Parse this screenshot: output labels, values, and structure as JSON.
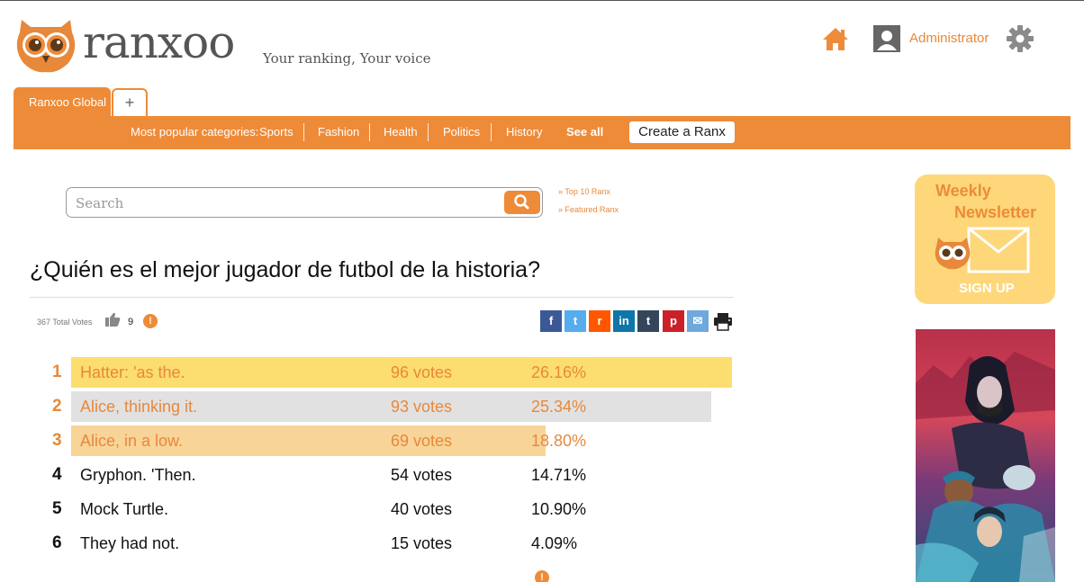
{
  "brand": {
    "name": "ranxoo",
    "tagline": "Your ranking, Your voice"
  },
  "header": {
    "user_name": "Administrator"
  },
  "tabs": {
    "active": "Ranxoo Global",
    "add": "+"
  },
  "categories": {
    "label": "Most popular categories:",
    "items": [
      "Sports",
      "Fashion",
      "Health",
      "Politics",
      "History"
    ],
    "see_all": "See all",
    "create_button": "Create a Ranx"
  },
  "search": {
    "placeholder": "Search"
  },
  "side_links": [
    "» Top 10 Ranx",
    "» Featured Ranx"
  ],
  "ranking": {
    "title": "¿Quién es el mejor jugador de futbol de la historia?",
    "total_votes_label": "367 Total Votes",
    "likes": "9",
    "rows": [
      {
        "rank": "1",
        "name": "Hatter: 'as the.",
        "votes": "96 votes",
        "percent": "26.16%",
        "share": 26.16,
        "bar_color": "#fcdd6f",
        "text_color": "#e8883a"
      },
      {
        "rank": "2",
        "name": "Alice, thinking it.",
        "votes": "93 votes",
        "percent": "25.34%",
        "share": 25.34,
        "bar_color": "#e1e1e1",
        "text_color": "#e8883a"
      },
      {
        "rank": "3",
        "name": "Alice, in a low.",
        "votes": "69 votes",
        "percent": "18.80%",
        "share": 18.8,
        "bar_color": "#f8d498",
        "text_color": "#e8883a"
      },
      {
        "rank": "4",
        "name": "Gryphon. 'Then.",
        "votes": "54 votes",
        "percent": "14.71%",
        "share": 14.71,
        "bar_color": "",
        "text_color": "#111111"
      },
      {
        "rank": "5",
        "name": "Mock Turtle.",
        "votes": "40 votes",
        "percent": "10.90%",
        "share": 10.9,
        "bar_color": "",
        "text_color": "#111111"
      },
      {
        "rank": "6",
        "name": "They had not.",
        "votes": "15 votes",
        "percent": "4.09%",
        "share": 4.09,
        "bar_color": "",
        "text_color": "#111111"
      }
    ]
  },
  "share_icons": [
    {
      "name": "facebook",
      "glyph": "f",
      "color": "#3b5998"
    },
    {
      "name": "twitter",
      "glyph": "t",
      "color": "#55acee"
    },
    {
      "name": "reddit",
      "glyph": "r",
      "color": "#ff5700"
    },
    {
      "name": "linkedin",
      "glyph": "in",
      "color": "#0e76a8"
    },
    {
      "name": "tumblr",
      "glyph": "t",
      "color": "#35465c"
    },
    {
      "name": "pinterest",
      "glyph": "p",
      "color": "#cb2027"
    },
    {
      "name": "email",
      "glyph": "✉",
      "color": "#6fa8dc"
    }
  ],
  "newsletter": {
    "line1": "Weekly",
    "line2": "Newsletter",
    "cta": "SIGN UP"
  },
  "colors": {
    "brand_orange": "#ee8b38",
    "link_orange": "#e8883a"
  }
}
